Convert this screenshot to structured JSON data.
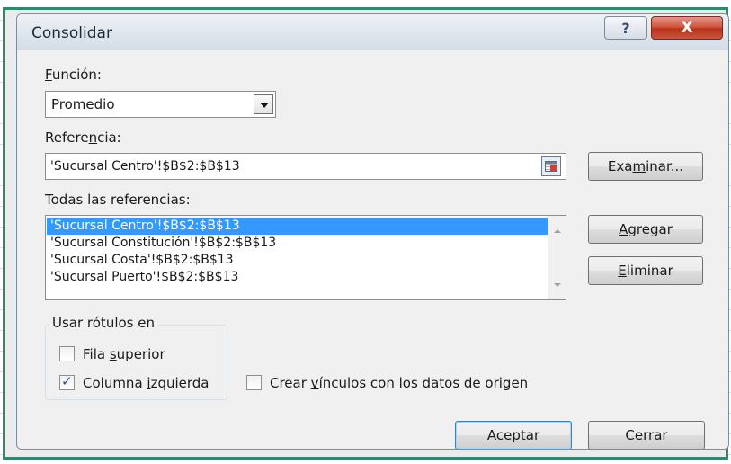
{
  "dialog": {
    "title": "Consolidar",
    "help_glyph": "?",
    "close_glyph": "X"
  },
  "funcion": {
    "label_mnemonic": "F",
    "label_rest": "unción:",
    "value": "Promedio"
  },
  "referencia": {
    "label_pre": "Refere",
    "label_mnemonic": "n",
    "label_post": "cia:",
    "value": "'Sucursal Centro'!$B$2:$B$13",
    "browse": {
      "pre": "Exa",
      "mnemonic": "m",
      "post": "inar..."
    }
  },
  "todas": {
    "label": "Todas las referencias:",
    "items": [
      "'Sucursal Centro'!$B$2:$B$13",
      "'Sucursal Constitución'!$B$2:$B$13",
      "'Sucursal Costa'!$B$2:$B$13",
      "'Sucursal Puerto'!$B$2:$B$13"
    ],
    "selected_index": 0,
    "add": {
      "mnemonic": "A",
      "rest": "gregar"
    },
    "remove": {
      "mnemonic": "E",
      "rest": "liminar"
    }
  },
  "rotulos": {
    "title": "Usar rótulos en",
    "fila": {
      "pre": "Fila ",
      "mnemonic": "s",
      "post": "uperior",
      "checked": false
    },
    "columna": {
      "pre": "Columna ",
      "mnemonic": "i",
      "post": "zquierda",
      "checked": true
    }
  },
  "vinculos": {
    "pre": "Crear ",
    "mnemonic": "v",
    "post": "ínculos con los datos de origen",
    "checked": false
  },
  "footer": {
    "ok_label": "Aceptar",
    "close_label": "Cerrar"
  },
  "colors": {
    "frame_accent": "#2e8a6e",
    "selection": "#3399ff",
    "close_red": "#c9553d"
  }
}
